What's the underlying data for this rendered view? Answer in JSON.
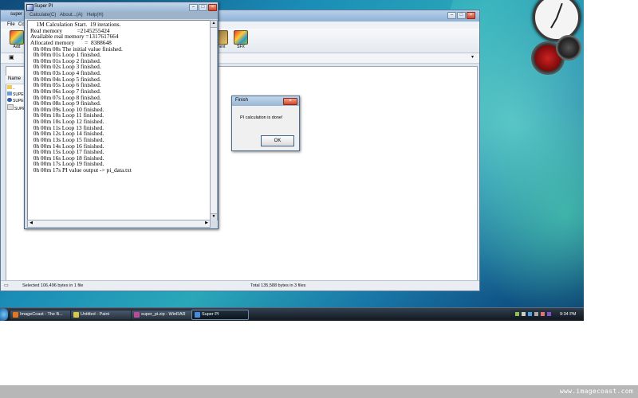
{
  "colors": {
    "desktop_accent": "#1a8db7",
    "taskbar": "#101820",
    "banner": "#b7b7b7"
  },
  "winrar": {
    "title": "super",
    "menu": [
      "File",
      "Co"
    ],
    "toolbar": [
      {
        "label": "Add",
        "icon": "winrar-add-icon"
      },
      {
        "label": "ment",
        "icon": "comment-icon"
      },
      {
        "label": "SFX",
        "icon": "sfx-icon"
      }
    ],
    "column_header": "Name",
    "sidebar_items": [
      "SUPER",
      "SUPE",
      "SUPER"
    ],
    "status_left": "Selected 106,496 bytes in 1 file",
    "status_right": "Total 135,588 bytes in 3 files"
  },
  "superpi": {
    "title": "Super PI",
    "menu": [
      "Calculate(C)",
      "About...(A)",
      "Help(H)"
    ],
    "output_lines": [
      "    1M Calculation Start.  19 iterations.",
      "Real memory          =2145255424",
      "Available real memory =1317617664",
      "Allocated memory       =  8388648",
      "  0h 00m 00s The initial value finished.",
      "  0h 00m 01s Loop 1 finished.",
      "  0h 00m 01s Loop 2 finished.",
      "  0h 00m 02s Loop 3 finished.",
      "  0h 00m 03s Loop 4 finished.",
      "  0h 00m 04s Loop 5 finished.",
      "  0h 00m 05s Loop 6 finished.",
      "  0h 00m 06s Loop 7 finished.",
      "  0h 00m 07s Loop 8 finished.",
      "  0h 00m 08s Loop 9 finished.",
      "  0h 00m 09s Loop 10 finished.",
      "  0h 00m 10s Loop 11 finished.",
      "  0h 00m 10s Loop 12 finished.",
      "  0h 00m 11s Loop 13 finished.",
      "  0h 00m 12s Loop 14 finished.",
      "  0h 00m 13s Loop 15 finished.",
      "  0h 00m 14s Loop 16 finished.",
      "  0h 00m 15s Loop 17 finished.",
      "  0h 00m 16s Loop 18 finished.",
      "  0h 00m 17s Loop 19 finished.",
      "  0h 00m 17s PI value output -> pi_data.txt"
    ]
  },
  "finish_dialog": {
    "title": "Finish",
    "message": "PI calculation is done!",
    "ok_label": "OK"
  },
  "taskbar": {
    "tasks": [
      {
        "label": "ImageCoast - The B...",
        "icon_color": "#e8741c"
      },
      {
        "label": "Untitled - Paint",
        "icon_color": "#d8c84a"
      },
      {
        "label": "super_pi.zip - WinRAR",
        "icon_color": "#b84a9a"
      },
      {
        "label": "Super PI",
        "icon_color": "#4a8ad8",
        "active": true
      }
    ],
    "clock": "9:34 PM"
  },
  "banner_text": "www.imagecoast.com"
}
